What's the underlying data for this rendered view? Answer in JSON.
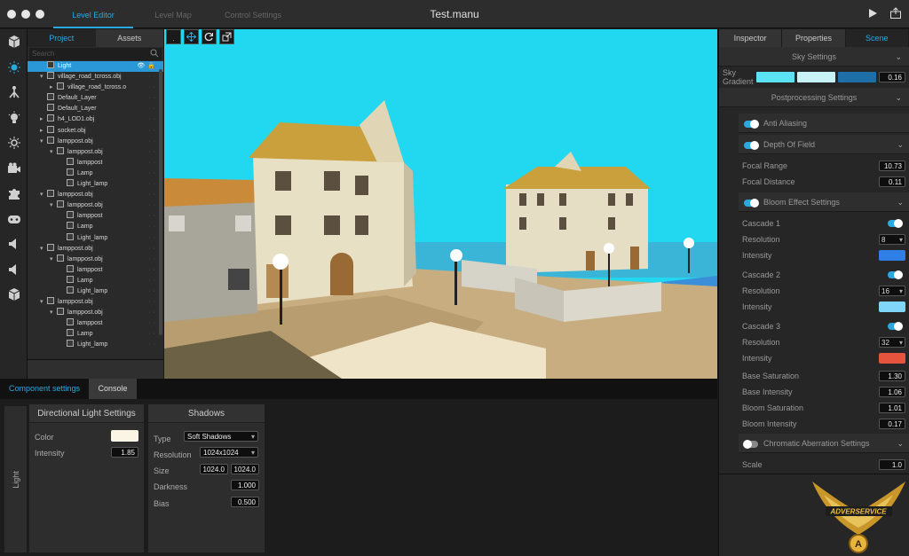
{
  "window": {
    "title": "Test.manu",
    "tabs": [
      {
        "label": "Level Editor",
        "active": true
      },
      {
        "label": "Level Map",
        "active": false
      },
      {
        "label": "Control Settings",
        "active": false
      }
    ]
  },
  "project_panel": {
    "tabs": [
      {
        "label": "Project",
        "active": true
      },
      {
        "label": "Assets",
        "active": false
      }
    ],
    "search_placeholder": "Search",
    "tree": [
      {
        "label": "Light",
        "depth": 0,
        "selected": true,
        "arrow": ""
      },
      {
        "label": "village_road_tcross.obj",
        "depth": 0,
        "arrow": "▾"
      },
      {
        "label": "village_road_tcross.o",
        "depth": 1,
        "arrow": "▸"
      },
      {
        "label": "Default_Layer",
        "depth": 0,
        "arrow": ""
      },
      {
        "label": "Default_Layer",
        "depth": 0,
        "arrow": ""
      },
      {
        "label": "h4_LOD1.obj",
        "depth": 0,
        "arrow": "▸"
      },
      {
        "label": "socket.obj",
        "depth": 0,
        "arrow": "▸"
      },
      {
        "label": "lamppost.obj",
        "depth": 0,
        "arrow": "▾"
      },
      {
        "label": "lamppost.obj",
        "depth": 1,
        "arrow": "▾"
      },
      {
        "label": "lamppost",
        "depth": 2,
        "arrow": ""
      },
      {
        "label": "Lamp",
        "depth": 2,
        "arrow": ""
      },
      {
        "label": "Light_lamp",
        "depth": 2,
        "arrow": ""
      },
      {
        "label": "lamppost.obj",
        "depth": 0,
        "arrow": "▾"
      },
      {
        "label": "lamppost.obj",
        "depth": 1,
        "arrow": "▾"
      },
      {
        "label": "lamppost",
        "depth": 2,
        "arrow": ""
      },
      {
        "label": "Lamp",
        "depth": 2,
        "arrow": ""
      },
      {
        "label": "Light_lamp",
        "depth": 2,
        "arrow": ""
      },
      {
        "label": "lamppost.obj",
        "depth": 0,
        "arrow": "▾"
      },
      {
        "label": "lamppost.obj",
        "depth": 1,
        "arrow": "▾"
      },
      {
        "label": "lamppost",
        "depth": 2,
        "arrow": ""
      },
      {
        "label": "Lamp",
        "depth": 2,
        "arrow": ""
      },
      {
        "label": "Light_lamp",
        "depth": 2,
        "arrow": ""
      },
      {
        "label": "lamppost.obj",
        "depth": 0,
        "arrow": "▾"
      },
      {
        "label": "lamppost.obj",
        "depth": 1,
        "arrow": "▾"
      },
      {
        "label": "lamppost",
        "depth": 2,
        "arrow": ""
      },
      {
        "label": "Lamp",
        "depth": 2,
        "arrow": ""
      },
      {
        "label": "Light_lamp",
        "depth": 2,
        "arrow": ""
      }
    ]
  },
  "right_panel": {
    "tabs": [
      {
        "label": "Inspector",
        "active": false
      },
      {
        "label": "Properties",
        "active": false
      },
      {
        "label": "Scene",
        "active": true
      }
    ],
    "sky_settings_label": "Sky Settings",
    "sky_gradient": {
      "label": "Sky Gradient",
      "colors": [
        "#5be3f5",
        "#c7f3f7",
        "#1e6fa8"
      ],
      "value": "0.16"
    },
    "postprocessing_label": "Postprocessing Settings",
    "anti_aliasing": {
      "label": "Anti Aliasing",
      "on": true
    },
    "depth_of_field": {
      "label": "Depth Of Field",
      "on": true
    },
    "focal_range": {
      "label": "Focal Range",
      "value": "10.73"
    },
    "focal_distance": {
      "label": "Focal Distance",
      "value": "0.11"
    },
    "bloom": {
      "label": "Bloom Effect Settings",
      "on": true
    },
    "cascades": [
      {
        "label": "Cascade 1",
        "resolution_label": "Resolution",
        "resolution": "8",
        "intensity_label": "Intensity",
        "color": "#2f7fe6"
      },
      {
        "label": "Cascade 2",
        "resolution_label": "Resolution",
        "resolution": "16",
        "intensity_label": "Intensity",
        "color": "#7fd6f8"
      },
      {
        "label": "Cascade 3",
        "resolution_label": "Resolution",
        "resolution": "32",
        "intensity_label": "Intensity",
        "color": "#e6543e"
      }
    ],
    "base_saturation": {
      "label": "Base Saturation",
      "value": "1.30"
    },
    "base_intensity": {
      "label": "Base Intensity",
      "value": "1.06"
    },
    "bloom_saturation": {
      "label": "Bloom Saturation",
      "value": "1.01"
    },
    "bloom_intensity": {
      "label": "Bloom Intensity",
      "value": "0.17"
    },
    "chromatic": {
      "label": "Chromatic Aberration Settings",
      "on": false
    },
    "scale": {
      "label": "Scale",
      "value": "1.0"
    },
    "logo_text": "ADVERSERVICE",
    "logo_letter": "A"
  },
  "bottom_panel": {
    "tabs": [
      {
        "label": "Component settings",
        "active": true
      },
      {
        "label": "Console",
        "active": false
      }
    ],
    "side_label": "Light",
    "directional": {
      "title": "Directional Light Settings",
      "color_label": "Color",
      "color": "#fbf5e6",
      "intensity_label": "Intensity",
      "intensity": "1.85"
    },
    "shadows": {
      "title": "Shadows",
      "type_label": "Type",
      "type": "Soft Shadows",
      "resolution_label": "Resolution",
      "resolution": "1024x1024",
      "size_label": "Size",
      "size_w": "1024.0",
      "size_h": "1024.0",
      "darkness_label": "Darkness",
      "darkness": "1.000",
      "bias_label": "Bias",
      "bias": "0.500"
    }
  },
  "colors": {
    "accent": "#2aa9e0",
    "sky": "#22d8f0"
  }
}
